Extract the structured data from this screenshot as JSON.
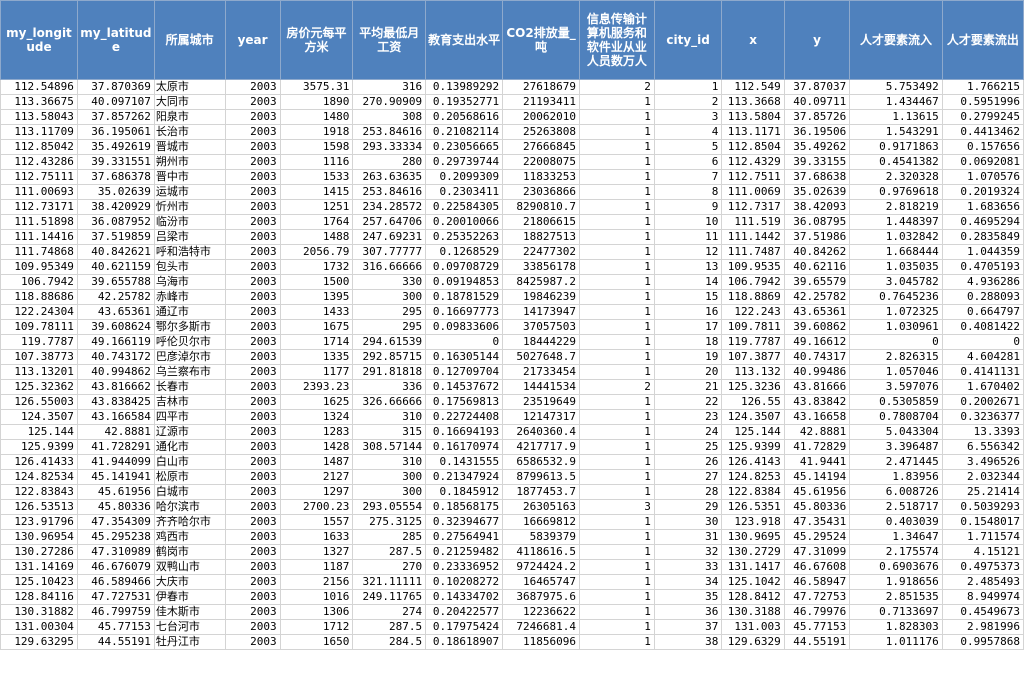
{
  "headers": [
    "my_longitude",
    "my_latitude",
    "所属城市",
    "year",
    "房价元每平方米",
    "平均最低月工资",
    "教育支出水平",
    "CO2排放量_吨",
    "信息传输计算机服务和软件业从业人员数万人",
    "city_id",
    "x",
    "y",
    "人才要素流入",
    "人才要素流出"
  ],
  "rows": [
    [
      "112.54896",
      "37.870369",
      "太原市",
      "2003",
      "3575.31",
      "316",
      "0.13989292",
      "27618679",
      "2",
      "1",
      "112.549",
      "37.87037",
      "5.753492",
      "1.766215"
    ],
    [
      "113.36675",
      "40.097107",
      "大同市",
      "2003",
      "1890",
      "270.90909",
      "0.19352771",
      "21193411",
      "1",
      "2",
      "113.3668",
      "40.09711",
      "1.434467",
      "0.5951996"
    ],
    [
      "113.58043",
      "37.857262",
      "阳泉市",
      "2003",
      "1480",
      "308",
      "0.20568616",
      "20062010",
      "1",
      "3",
      "113.5804",
      "37.85726",
      "1.13615",
      "0.2799245"
    ],
    [
      "113.11709",
      "36.195061",
      "长治市",
      "2003",
      "1918",
      "253.84616",
      "0.21082114",
      "25263808",
      "1",
      "4",
      "113.1171",
      "36.19506",
      "1.543291",
      "0.4413462"
    ],
    [
      "112.85042",
      "35.492619",
      "晋城市",
      "2003",
      "1598",
      "293.33334",
      "0.23056665",
      "27666845",
      "1",
      "5",
      "112.8504",
      "35.49262",
      "0.9171863",
      "0.157656"
    ],
    [
      "112.43286",
      "39.331551",
      "朔州市",
      "2003",
      "1116",
      "280",
      "0.29739744",
      "22008075",
      "1",
      "6",
      "112.4329",
      "39.33155",
      "0.4541382",
      "0.0692081"
    ],
    [
      "112.75111",
      "37.686378",
      "晋中市",
      "2003",
      "1533",
      "263.63635",
      "0.2099309",
      "11833253",
      "1",
      "7",
      "112.7511",
      "37.68638",
      "2.320328",
      "1.070576"
    ],
    [
      "111.00693",
      "35.02639",
      "运城市",
      "2003",
      "1415",
      "253.84616",
      "0.2303411",
      "23036866",
      "1",
      "8",
      "111.0069",
      "35.02639",
      "0.9769618",
      "0.2019324"
    ],
    [
      "112.73171",
      "38.420929",
      "忻州市",
      "2003",
      "1251",
      "234.28572",
      "0.22584305",
      "8290810.7",
      "1",
      "9",
      "112.7317",
      "38.42093",
      "2.818219",
      "1.683656"
    ],
    [
      "111.51898",
      "36.087952",
      "临汾市",
      "2003",
      "1764",
      "257.64706",
      "0.20010066",
      "21806615",
      "1",
      "10",
      "111.519",
      "36.08795",
      "1.448397",
      "0.4695294"
    ],
    [
      "111.14416",
      "37.519859",
      "吕梁市",
      "2003",
      "1488",
      "247.69231",
      "0.25352263",
      "18827513",
      "1",
      "11",
      "111.1442",
      "37.51986",
      "1.032842",
      "0.2835849"
    ],
    [
      "111.74868",
      "40.842621",
      "呼和浩特市",
      "2003",
      "2056.79",
      "307.77777",
      "0.1268529",
      "22477302",
      "1",
      "12",
      "111.7487",
      "40.84262",
      "1.668444",
      "1.044359"
    ],
    [
      "109.95349",
      "40.621159",
      "包头市",
      "2003",
      "1732",
      "316.66666",
      "0.09708729",
      "33856178",
      "1",
      "13",
      "109.9535",
      "40.62116",
      "1.035035",
      "0.4705193"
    ],
    [
      "106.7942",
      "39.655788",
      "乌海市",
      "2003",
      "1500",
      "330",
      "0.09194853",
      "8425987.2",
      "1",
      "14",
      "106.7942",
      "39.65579",
      "3.045782",
      "4.936286"
    ],
    [
      "118.88686",
      "42.25782",
      "赤峰市",
      "2003",
      "1395",
      "300",
      "0.18781529",
      "19846239",
      "1",
      "15",
      "118.8869",
      "42.25782",
      "0.7645236",
      "0.288093"
    ],
    [
      "122.24304",
      "43.65361",
      "通辽市",
      "2003",
      "1433",
      "295",
      "0.16697773",
      "14173947",
      "1",
      "16",
      "122.243",
      "43.65361",
      "1.072325",
      "0.664797"
    ],
    [
      "109.78111",
      "39.608624",
      "鄂尔多斯市",
      "2003",
      "1675",
      "295",
      "0.09833606",
      "37057503",
      "1",
      "17",
      "109.7811",
      "39.60862",
      "1.030961",
      "0.4081422"
    ],
    [
      "119.7787",
      "49.166119",
      "呼伦贝尔市",
      "2003",
      "1714",
      "294.61539",
      "0",
      "18444229",
      "1",
      "18",
      "119.7787",
      "49.16612",
      "0",
      "0"
    ],
    [
      "107.38773",
      "40.743172",
      "巴彦淖尔市",
      "2003",
      "1335",
      "292.85715",
      "0.16305144",
      "5027648.7",
      "1",
      "19",
      "107.3877",
      "40.74317",
      "2.826315",
      "4.604281"
    ],
    [
      "113.13201",
      "40.994862",
      "乌兰察布市",
      "2003",
      "1177",
      "291.81818",
      "0.12709704",
      "21733454",
      "1",
      "20",
      "113.132",
      "40.99486",
      "1.057046",
      "0.4141131"
    ],
    [
      "125.32362",
      "43.816662",
      "长春市",
      "2003",
      "2393.23",
      "336",
      "0.14537672",
      "14441534",
      "2",
      "21",
      "125.3236",
      "43.81666",
      "3.597076",
      "1.670402"
    ],
    [
      "126.55003",
      "43.838425",
      "吉林市",
      "2003",
      "1625",
      "326.66666",
      "0.17569813",
      "23519649",
      "1",
      "22",
      "126.55",
      "43.83842",
      "0.5305859",
      "0.2002671"
    ],
    [
      "124.3507",
      "43.166584",
      "四平市",
      "2003",
      "1324",
      "310",
      "0.22724408",
      "12147317",
      "1",
      "23",
      "124.3507",
      "43.16658",
      "0.7808704",
      "0.3236377"
    ],
    [
      "125.144",
      "42.8881",
      "辽源市",
      "2003",
      "1283",
      "315",
      "0.16694193",
      "2640360.4",
      "1",
      "24",
      "125.144",
      "42.8881",
      "5.043304",
      "13.3393"
    ],
    [
      "125.9399",
      "41.728291",
      "通化市",
      "2003",
      "1428",
      "308.57144",
      "0.16170974",
      "4217717.9",
      "1",
      "25",
      "125.9399",
      "41.72829",
      "3.396487",
      "6.556342"
    ],
    [
      "126.41433",
      "41.944099",
      "白山市",
      "2003",
      "1487",
      "310",
      "0.1431555",
      "6586532.9",
      "1",
      "26",
      "126.4143",
      "41.9441",
      "2.471445",
      "3.496526"
    ],
    [
      "124.82534",
      "45.141941",
      "松原市",
      "2003",
      "2127",
      "300",
      "0.21347924",
      "8799613.5",
      "1",
      "27",
      "124.8253",
      "45.14194",
      "1.83956",
      "2.032344"
    ],
    [
      "122.83843",
      "45.61956",
      "白城市",
      "2003",
      "1297",
      "300",
      "0.1845912",
      "1877453.7",
      "1",
      "28",
      "122.8384",
      "45.61956",
      "6.008726",
      "25.21414"
    ],
    [
      "126.53513",
      "45.80336",
      "哈尔滨市",
      "2003",
      "2700.23",
      "293.05554",
      "0.18568175",
      "26305163",
      "3",
      "29",
      "126.5351",
      "45.80336",
      "2.518717",
      "0.5039293"
    ],
    [
      "123.91796",
      "47.354309",
      "齐齐哈尔市",
      "2003",
      "1557",
      "275.3125",
      "0.32394677",
      "16669812",
      "1",
      "30",
      "123.918",
      "47.35431",
      "0.403039",
      "0.1548017"
    ],
    [
      "130.96954",
      "45.295238",
      "鸡西市",
      "2003",
      "1633",
      "285",
      "0.27564941",
      "5839379",
      "1",
      "31",
      "130.9695",
      "45.29524",
      "1.34647",
      "1.711574"
    ],
    [
      "130.27286",
      "47.310989",
      "鹤岗市",
      "2003",
      "1327",
      "287.5",
      "0.21259482",
      "4118616.5",
      "1",
      "32",
      "130.2729",
      "47.31099",
      "2.175574",
      "4.15121"
    ],
    [
      "131.14169",
      "46.676079",
      "双鸭山市",
      "2003",
      "1187",
      "270",
      "0.23336952",
      "9724424.2",
      "1",
      "33",
      "131.1417",
      "46.67608",
      "0.6903676",
      "0.4975373"
    ],
    [
      "125.10423",
      "46.589466",
      "大庆市",
      "2003",
      "2156",
      "321.11111",
      "0.10208272",
      "16465747",
      "1",
      "34",
      "125.1042",
      "46.58947",
      "1.918656",
      "2.485493"
    ],
    [
      "128.84116",
      "47.727531",
      "伊春市",
      "2003",
      "1016",
      "249.11765",
      "0.14334702",
      "3687975.6",
      "1",
      "35",
      "128.8412",
      "47.72753",
      "2.851535",
      "8.949974"
    ],
    [
      "130.31882",
      "46.799759",
      "佳木斯市",
      "2003",
      "1306",
      "274",
      "0.20422577",
      "12236622",
      "1",
      "36",
      "130.3188",
      "46.79976",
      "0.7133697",
      "0.4549673"
    ],
    [
      "131.00304",
      "45.77153",
      "七台河市",
      "2003",
      "1712",
      "287.5",
      "0.17975424",
      "7246681.4",
      "1",
      "37",
      "131.003",
      "45.77153",
      "1.828303",
      "2.981996"
    ],
    [
      "129.63295",
      "44.55191",
      "牡丹江市",
      "2003",
      "1650",
      "284.5",
      "0.18618907",
      "11856096",
      "1",
      "38",
      "129.6329",
      "44.55191",
      "1.011176",
      "0.9957868"
    ]
  ]
}
